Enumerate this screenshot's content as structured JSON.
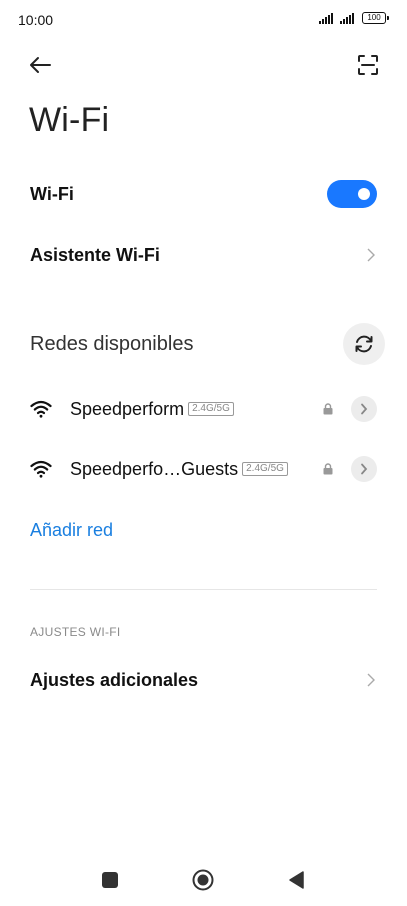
{
  "status_bar": {
    "time": "10:00",
    "battery": "100"
  },
  "header": {
    "title": "Wi-Fi"
  },
  "wifi_toggle": {
    "label": "Wi-Fi",
    "enabled": true,
    "accent": "#1978ff"
  },
  "assistant": {
    "label": "Asistente Wi-Fi"
  },
  "networks": {
    "title": "Redes disponibles",
    "items": [
      {
        "name": "Speedperform",
        "band": "2.4G/5G"
      },
      {
        "name": "Speedperfo…Guests",
        "band": "2.4G/5G"
      }
    ]
  },
  "add_network": {
    "label": "Añadir red",
    "color": "#1a7fe0"
  },
  "settings_section": {
    "label": "AJUSTES WI-FI",
    "extra": "Ajustes adicionales"
  }
}
